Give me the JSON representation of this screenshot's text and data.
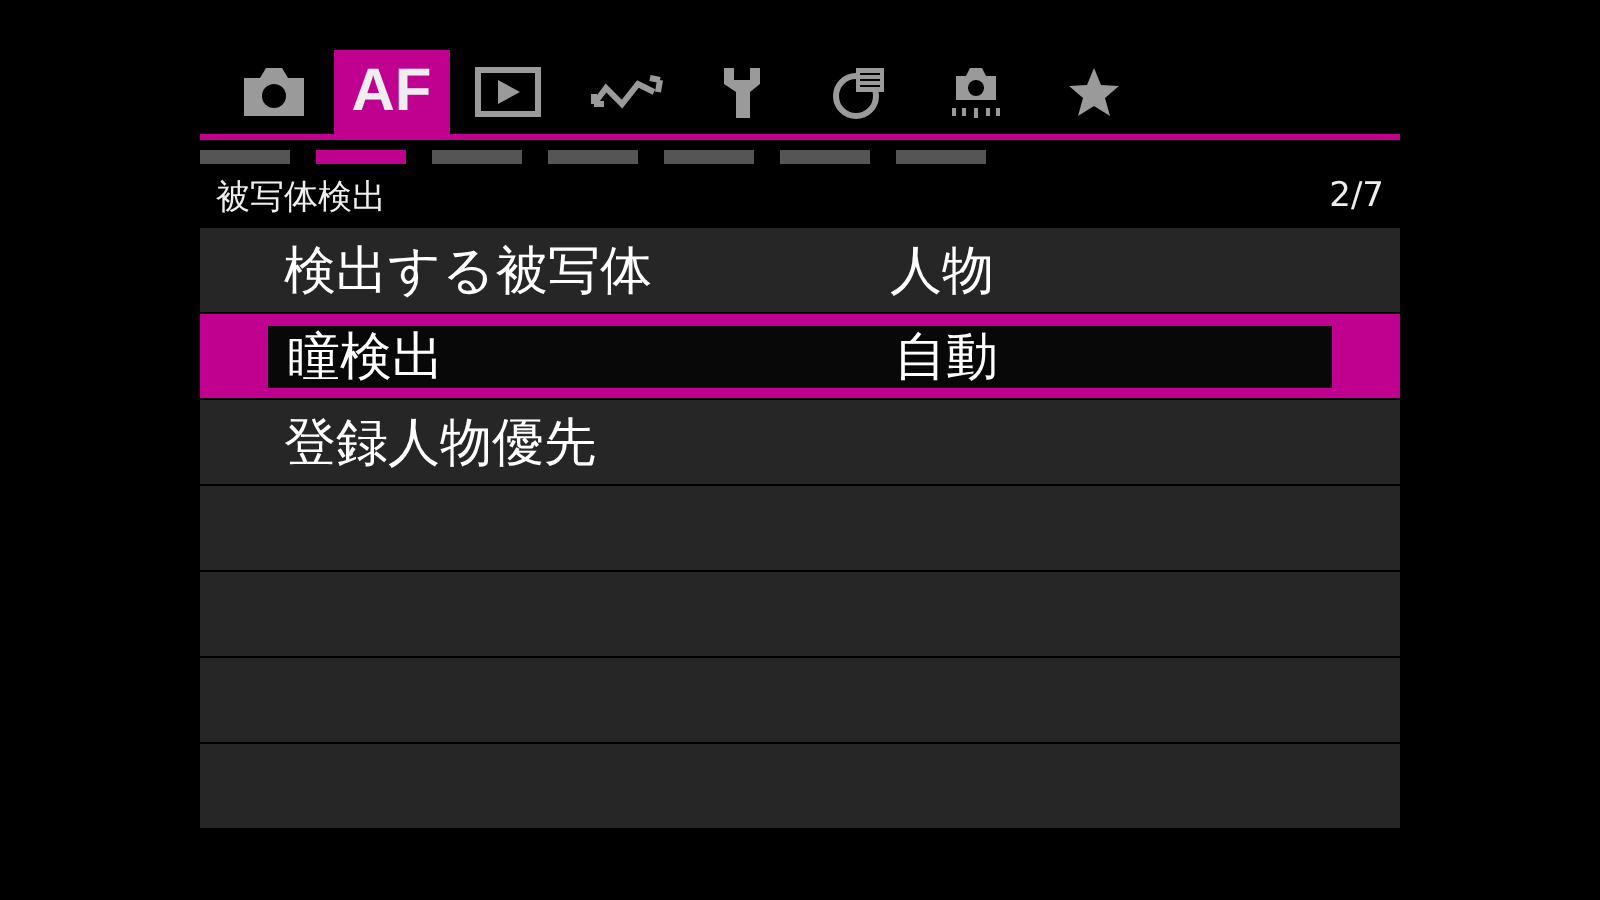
{
  "tabs": [
    {
      "kind": "icon",
      "selected": false
    },
    {
      "kind": "text",
      "label": "AF",
      "selected": true
    },
    {
      "kind": "icon",
      "selected": false
    },
    {
      "kind": "icon",
      "selected": false
    },
    {
      "kind": "icon",
      "selected": false
    },
    {
      "kind": "icon",
      "selected": false
    },
    {
      "kind": "icon",
      "selected": false
    },
    {
      "kind": "icon",
      "selected": false
    }
  ],
  "pages": [
    {
      "selected": false
    },
    {
      "selected": true
    },
    {
      "selected": false
    },
    {
      "selected": false
    },
    {
      "selected": false
    },
    {
      "selected": false
    },
    {
      "selected": false
    }
  ],
  "header": {
    "title": "被写体検出",
    "page": "2/7"
  },
  "rows": [
    {
      "label": "検出する被写体",
      "value": "人物",
      "selected": false
    },
    {
      "label": "瞳検出",
      "value": "自動",
      "selected": true
    },
    {
      "label": "登録人物優先",
      "selected": false
    }
  ]
}
